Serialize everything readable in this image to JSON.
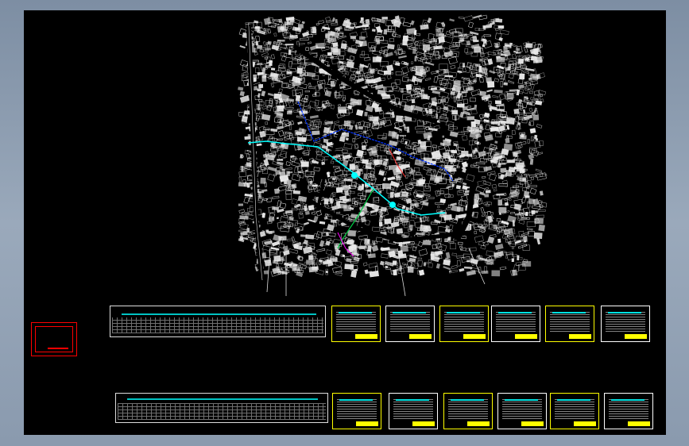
{
  "viewer": {
    "background_color": "#000000",
    "frame_color": "#8a9aae",
    "drawing_color": "#ffffff",
    "route_colors": [
      "#00ffff",
      "#0033ff",
      "#00cc44",
      "#ff3333",
      "#ff00ff"
    ]
  },
  "sheets": {
    "row_top_count": 6,
    "row_bottom_count": 6,
    "sheet_border_colors": [
      "#ffff00",
      "#ffffff"
    ],
    "title_block_color": "#ffff00"
  },
  "legend": {
    "border_color": "#ff0000"
  }
}
